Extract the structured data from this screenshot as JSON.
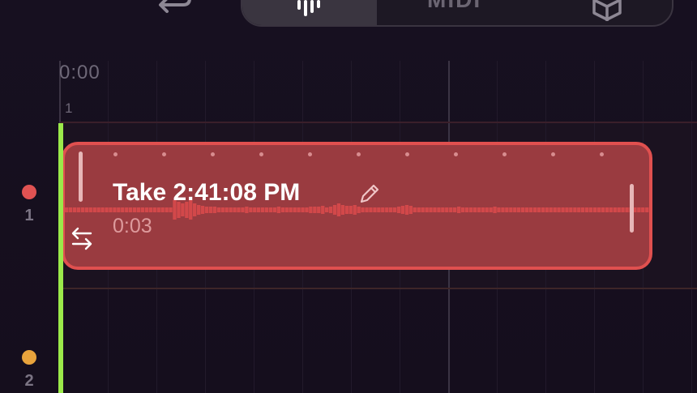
{
  "topbar": {
    "undo_icon": "undo-arrow-icon",
    "segments": [
      {
        "id": "audio",
        "icon": "waveform-icon",
        "selected": true
      },
      {
        "id": "midi",
        "label": "MIDI",
        "selected": false
      },
      {
        "id": "3d",
        "icon": "cube-icon",
        "selected": false
      }
    ]
  },
  "timeline": {
    "time_label": "0:00",
    "bar_label": "1"
  },
  "tracks": [
    {
      "number": "1",
      "color": "#e05252"
    },
    {
      "number": "2",
      "color": "#e8a33c"
    }
  ],
  "clip": {
    "title": "Take 2:41:08 PM",
    "duration": "0:03",
    "color": "#9a3b40",
    "border_color": "#e0504f"
  },
  "playhead_color": "#9be94a"
}
